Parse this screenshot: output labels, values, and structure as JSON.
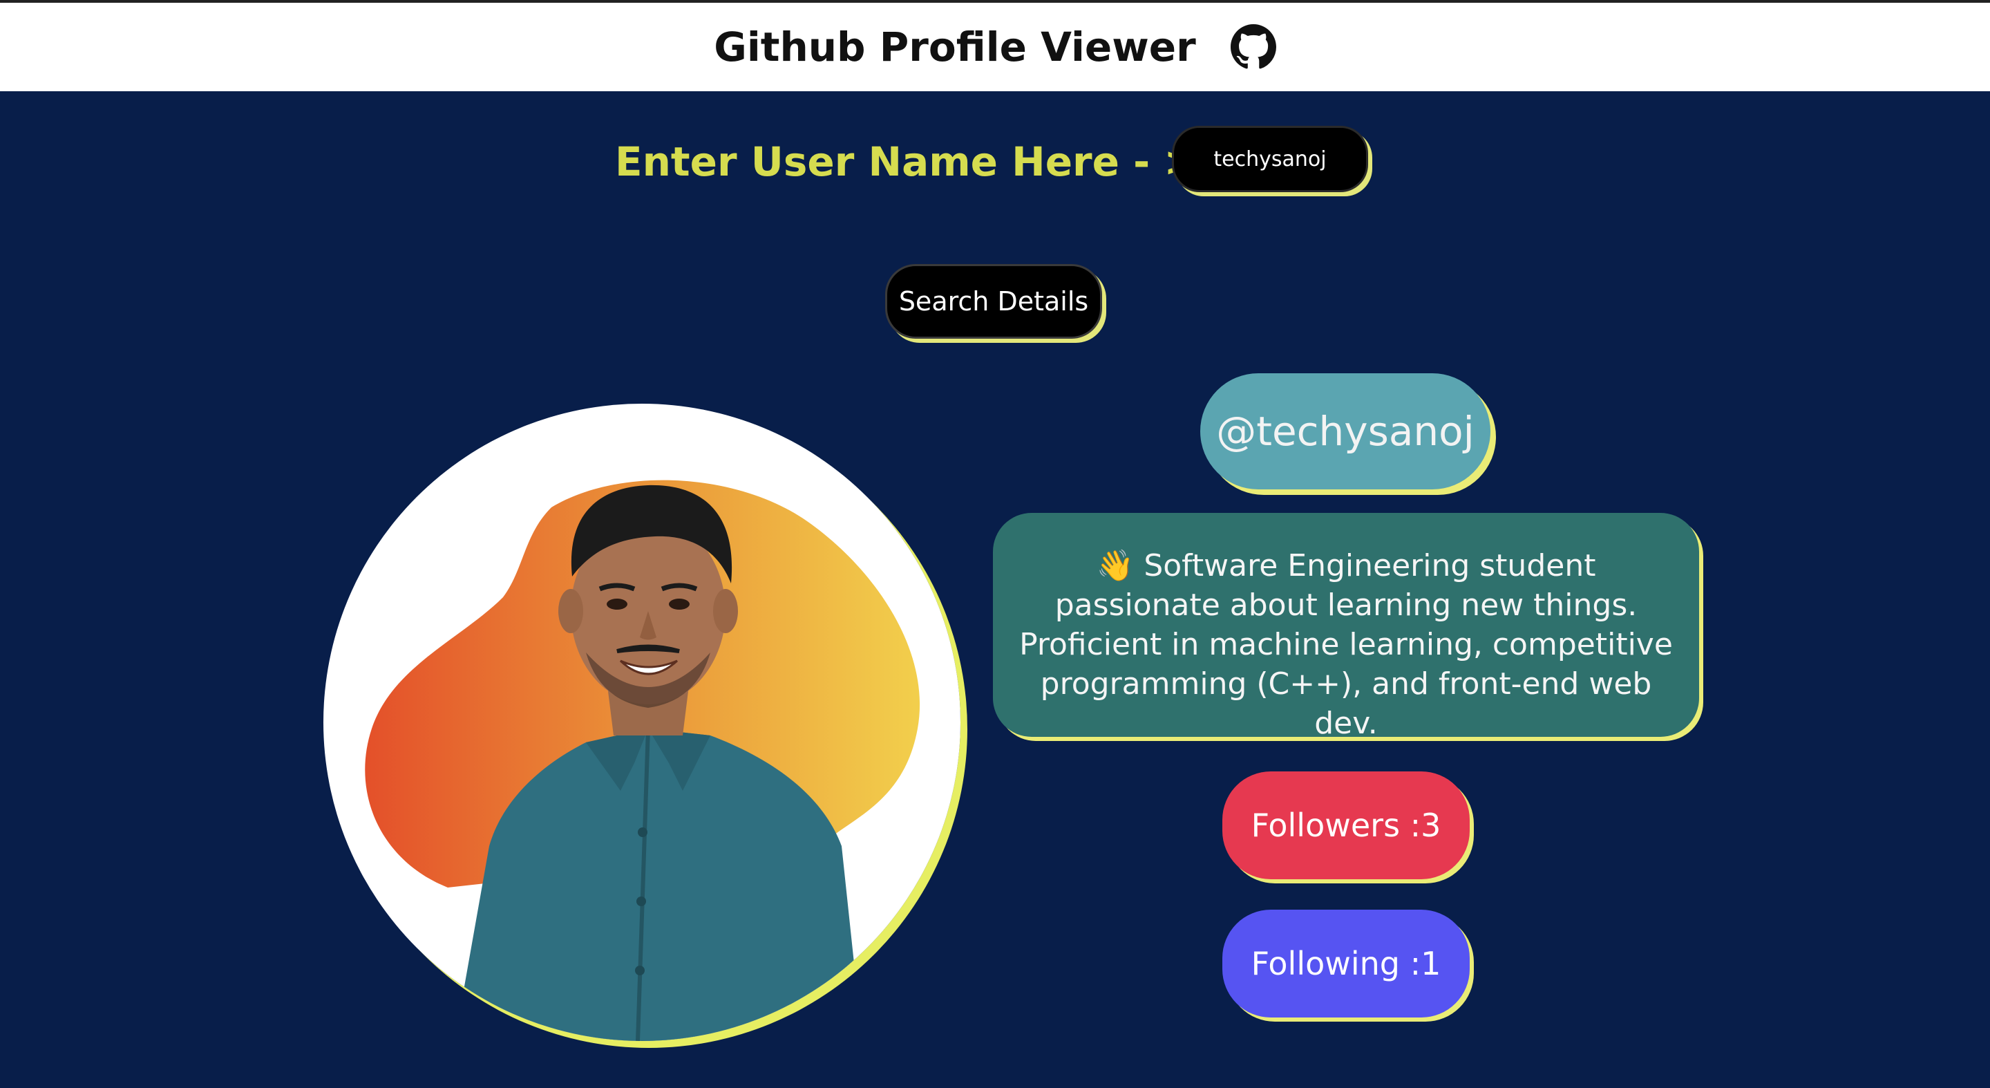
{
  "header": {
    "title": "Github Profile Viewer",
    "icon": "github-icon"
  },
  "search": {
    "label": "Enter User Name Here - >",
    "input_value": "techysanoj",
    "button_label": "Search Details"
  },
  "profile": {
    "avatar": "profile-photo",
    "handle": "@techysanoj",
    "bio": "👋 Software Engineering student passionate about learning new things. Proficient in machine learning, competitive programming (C++), and front-end web dev.",
    "followers_label": "Followers :",
    "followers_count": "3",
    "following_label": "Following :",
    "following_count": "1"
  },
  "colors": {
    "background": "#081e4a",
    "accent_yellow": "#d6dc4f",
    "handle_bg": "#5ba5b1",
    "bio_bg": "#2f716d",
    "followers_bg": "#e63950",
    "following_bg": "#5654f2"
  }
}
